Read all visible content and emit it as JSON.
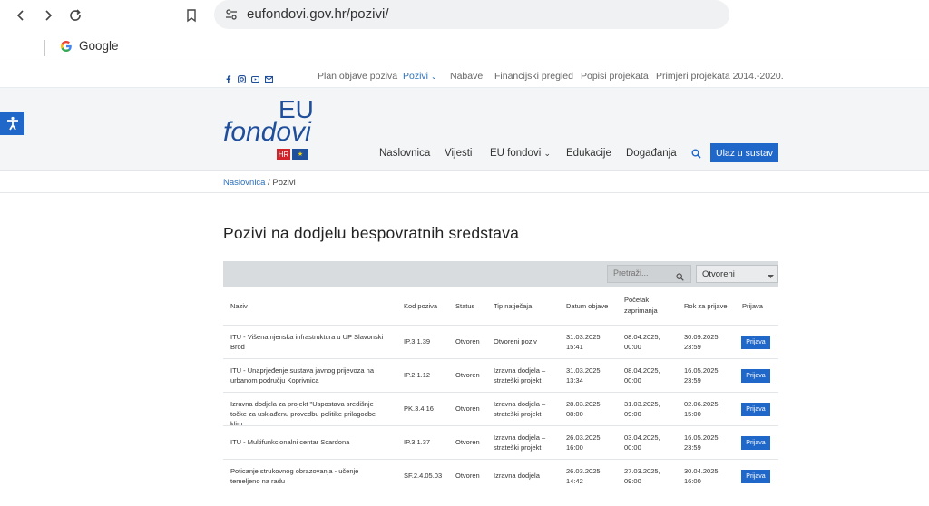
{
  "browser": {
    "url": "eufondovi.gov.hr/pozivi/",
    "bookmark": "Google"
  },
  "topnav": {
    "items": [
      {
        "label": "Plan objave poziva",
        "active": false
      },
      {
        "label": "Pozivi",
        "active": true,
        "has_dropdown": true
      },
      {
        "label": "Nabave",
        "active": false
      },
      {
        "label": "Financijski pregled",
        "active": false
      },
      {
        "label": "Popisi projekata",
        "active": false
      },
      {
        "label": "Primjeri projekata 2014.-2020.",
        "active": false
      }
    ],
    "social_icons": [
      "facebook-icon",
      "instagram-icon",
      "youtube-icon",
      "email-icon"
    ]
  },
  "logo": {
    "eu": "EU",
    "fondovi": "fondovi",
    "hr": "HR"
  },
  "mainnav": {
    "items": [
      {
        "label": "Naslovnica"
      },
      {
        "label": "Vijesti"
      },
      {
        "label": "EU fondovi",
        "has_dropdown": true
      },
      {
        "label": "Edukacije"
      },
      {
        "label": "Događanja"
      }
    ],
    "login": "Ulaz u sustav"
  },
  "breadcrumb": {
    "home": "Naslovnica",
    "separator": " / ",
    "current": "Pozivi"
  },
  "page": {
    "title": "Pozivi na dodjelu bespovratnih sredstava"
  },
  "filters": {
    "search_placeholder": "Pretraži...",
    "status_selected": "Otvoreni"
  },
  "table": {
    "headers": [
      "Naziv",
      "Kod poziva",
      "Status",
      "Tip natječaja",
      "Datum objave",
      "Početak zaprimanja",
      "Rok za prijave",
      "Prijava"
    ],
    "rows": [
      {
        "naziv": "ITU - Višenamjenska infrastruktura u UP Slavonski Brod",
        "kod": "IP.3.1.39",
        "status": "Otvoren",
        "tip": "Otvoreni poziv",
        "objava": "31.03.2025, 15:41",
        "pocetak": "08.04.2025, 00:00",
        "rok": "30.09.2025, 23:59",
        "prijava": "Prijava"
      },
      {
        "naziv": "ITU - Unaprjeđenje sustava javnog prijevoza na urbanom području Koprivnica",
        "kod": "IP.2.1.12",
        "status": "Otvoren",
        "tip": "Izravna dodjela – strateški projekt",
        "objava": "31.03.2025, 13:34",
        "pocetak": "08.04.2025, 00:00",
        "rok": "16.05.2025, 23:59",
        "prijava": "Prijava"
      },
      {
        "naziv": "Izravna dodjela za projekt \"Uspostava središnje točke za usklađenu provedbu politike prilagodbe klim...",
        "kod": "PK.3.4.16",
        "status": "Otvoren",
        "tip": "Izravna dodjela – strateški projekt",
        "objava": "28.03.2025, 08:00",
        "pocetak": "31.03.2025, 09:00",
        "rok": "02.06.2025, 15:00",
        "prijava": "Prijava"
      },
      {
        "naziv": "ITU - Multifunkcionalni centar Scardona",
        "kod": "IP.3.1.37",
        "status": "Otvoren",
        "tip": "Izravna dodjela – strateški projekt",
        "objava": "26.03.2025, 16:00",
        "pocetak": "03.04.2025, 00:00",
        "rok": "16.05.2025, 23:59",
        "prijava": "Prijava"
      },
      {
        "naziv": "Poticanje strukovnog obrazovanja - učenje temeljeno na radu",
        "kod": "SF.2.4.05.03",
        "status": "Otvoren",
        "tip": "Izravna dodjela",
        "objava": "26.03.2025, 14:42",
        "pocetak": "27.03.2025, 09:00",
        "rok": "30.04.2025, 16:00",
        "prijava": "Prijava"
      }
    ]
  }
}
